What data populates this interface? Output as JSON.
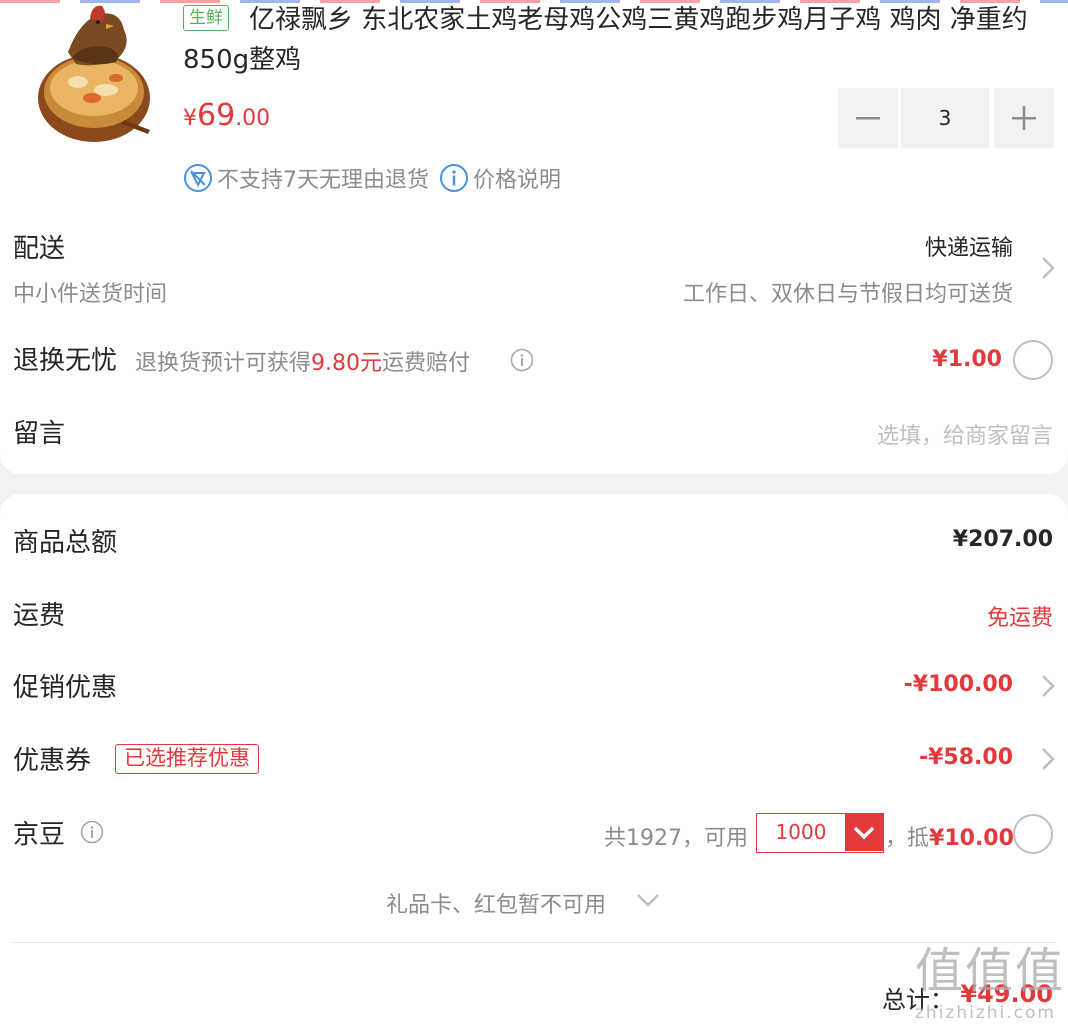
{
  "product": {
    "tag": "生鲜",
    "title": "亿禄飘乡 东北农家土鸡老母鸡公鸡三黄鸡跑步鸡月子鸡 鸡肉 净重约850g整鸡",
    "price_symbol": "¥",
    "price_int": "69",
    "price_dec": ".00",
    "quantity": "3",
    "policy_no_return": "不支持7天无理由退货",
    "policy_price_note": "价格说明",
    "image_icon": "roast-chicken-dish-image"
  },
  "delivery": {
    "label": "配送",
    "sublabel": "中小件送货时间",
    "method": "快递运输",
    "schedule": "工作日、双休日与节假日均可送货"
  },
  "return_insurance": {
    "label": "退换无忧",
    "desc_prefix": "退换货预计可获得",
    "desc_amount": "9.80元",
    "desc_suffix": "运费赔付",
    "price": "¥1.00"
  },
  "message": {
    "label": "留言",
    "placeholder": "选填，给商家留言"
  },
  "summary": {
    "goods_total_label": "商品总额",
    "goods_total_value": "¥207.00",
    "shipping_label": "运费",
    "shipping_value": "免运费",
    "promo_label": "促销优惠",
    "promo_value": "-¥100.00",
    "coupon_label": "优惠券",
    "coupon_tag": "已选推荐优惠",
    "coupon_value": "-¥58.00",
    "jd_bean_label": "京豆",
    "jd_bean_total": "共1927，可用",
    "jd_bean_selected": "1000",
    "jd_bean_deduct_prefix": "，抵",
    "jd_bean_deduct_value": "¥10.00",
    "gift_card_note": "礼品卡、红包暂不可用",
    "total_label": "总计：",
    "total_value": "¥49.00"
  },
  "watermark": {
    "text_big": "值值值",
    "text_small": "zhizhizhi.com"
  },
  "colors": {
    "accent_red": "#e4393c",
    "fresh_green": "#56b35a",
    "muted_gray": "#8c8c8c",
    "info_blue": "#4a90e2"
  }
}
